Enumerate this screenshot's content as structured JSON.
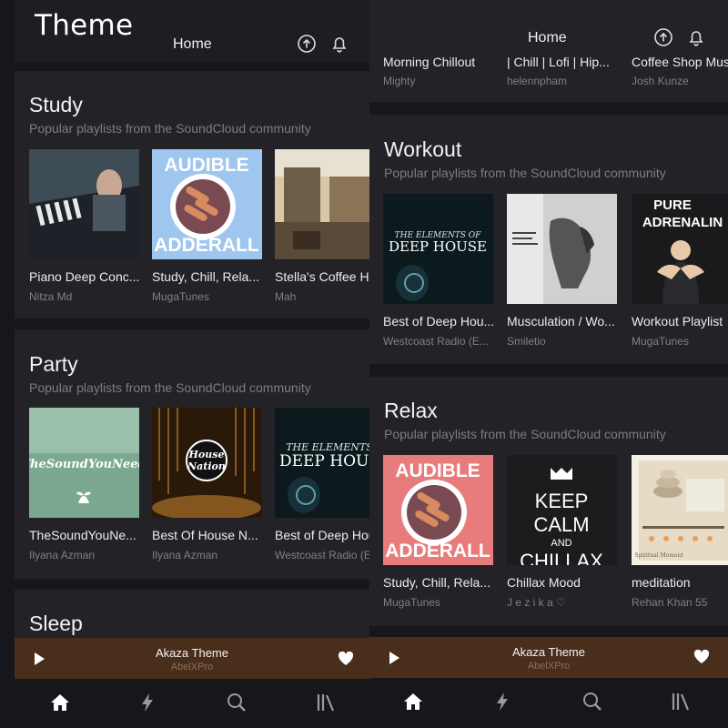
{
  "theme_label": "Theme",
  "left": {
    "header": {
      "title": "Home"
    },
    "sections": [
      {
        "title": "Study",
        "subtitle": "Popular playlists from the SoundCloud community",
        "cards": [
          {
            "title": "Piano Deep Conc...",
            "author": "Nitza Md"
          },
          {
            "title": "Study, Chill, Rela...",
            "author": "MugaTunes",
            "art_text_top": "AUDIBLE",
            "art_text_bottom": "ADDERALL"
          },
          {
            "title": "Stella's Coffee H",
            "author": "Mah"
          }
        ]
      },
      {
        "title": "Party",
        "subtitle": "Popular playlists from the SoundCloud community",
        "cards": [
          {
            "title": "TheSoundYouNe...",
            "author": "Ilyana Azman",
            "art_text": "TheSoundYouNeed"
          },
          {
            "title": "Best Of House N...",
            "author": "Ilyana Azman",
            "art_text_top": "House",
            "art_text_bottom": "Nation"
          },
          {
            "title": "Best of Deep Hou",
            "author": "Westcoast Radio (E",
            "art_text_top": "THE ELEMENTS",
            "art_text_bottom": "DEEP HOUS"
          }
        ]
      },
      {
        "title": "Sleep"
      }
    ],
    "player": {
      "track": "Akaza Theme",
      "artist": "AbelXPro"
    }
  },
  "right": {
    "header": {
      "title": "Home"
    },
    "top_cards": [
      {
        "title": "Morning Chillout",
        "author": "Mighty"
      },
      {
        "title": "| Chill | Lofi | Hip...",
        "author": "helennpham"
      },
      {
        "title": "Coffee Shop Mus",
        "author": "Josh Kunze"
      }
    ],
    "sections": [
      {
        "title": "Workout",
        "subtitle": "Popular playlists from the SoundCloud community",
        "cards": [
          {
            "title": "Best of Deep Hou...",
            "author": "Westcoast Radio (E...",
            "art_text_top": "THE ELEMENTS OF",
            "art_text_bottom": "DEEP HOUSE"
          },
          {
            "title": "Musculation / Wo...",
            "author": "Smiletio"
          },
          {
            "title": "Workout Playlist",
            "author": "MugaTunes",
            "art_text_top": "PURE",
            "art_text_bottom": "ADRENALIN"
          }
        ]
      },
      {
        "title": "Relax",
        "subtitle": "Popular playlists from the SoundCloud community",
        "cards": [
          {
            "title": "Study, Chill, Rela...",
            "author": "MugaTunes",
            "art_text_top": "AUDIBLE",
            "art_text_bottom": "ADDERALL"
          },
          {
            "title": "Chillax Mood",
            "author": "J e z i k a ♡",
            "art_lines": [
              "KEEP",
              "CALM",
              "AND",
              "CHILLAX"
            ]
          },
          {
            "title": "meditation",
            "author": "Rehan Khan 55",
            "art_text": "Spiritual Moment"
          }
        ]
      }
    ],
    "player": {
      "track": "Akaza Theme",
      "artist": "AbelXPro"
    }
  },
  "icons": {
    "upload": "upload-circle-icon",
    "bell": "bell-icon",
    "play": "play-icon",
    "heart": "heart-icon",
    "home": "home-icon",
    "stream": "lightning-icon",
    "search": "search-icon",
    "library": "library-icon"
  },
  "colors": {
    "background": "#17161a",
    "section": "#232226",
    "header": "#1e1d21",
    "player": "#4a2e1c",
    "text": "#ececec",
    "muted": "#808085"
  }
}
